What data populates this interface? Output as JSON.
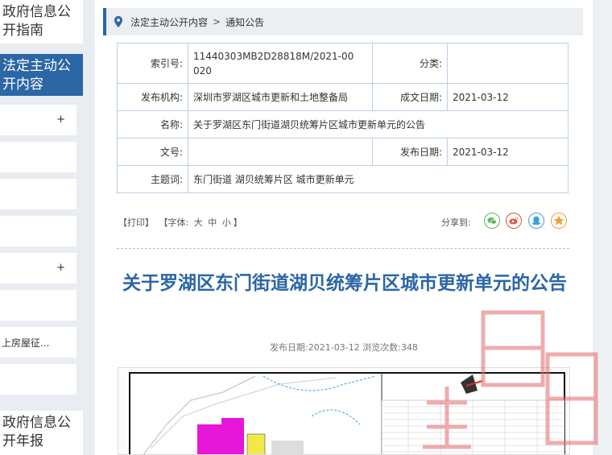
{
  "sidebar": {
    "guide": "政府信息公开指南",
    "active": "法定主动公开内容",
    "items": [
      "",
      "",
      "",
      "",
      "",
      "",
      "上房屋征...",
      ""
    ],
    "annual": "政府信息公开年报"
  },
  "breadcrumb": {
    "level1": "法定主动公开内容",
    "separator": ">",
    "level2": "通知公告"
  },
  "meta": {
    "index_label": "索引号:",
    "index_value": "11440303MB2D28818M/2021-00020",
    "category_label": "分类:",
    "category_value": "",
    "org_label": "发布机构:",
    "org_value": "深圳市罗湖区城市更新和土地整备局",
    "date_written_label": "成文日期:",
    "date_written_value": "2021-03-12",
    "name_label": "名称:",
    "name_value": "关于罗湖区东门街道湖贝统筹片区城市更新单元的公告",
    "docno_label": "文号:",
    "docno_value": "",
    "pub_date_label": "发布日期:",
    "pub_date_value": "2021-03-12",
    "subject_label": "主题词:",
    "subject_value": "东门街道 湖贝统筹片区 城市更新单元"
  },
  "tools": {
    "print": "【打印】",
    "font_label": "【字体:",
    "font_big": "大",
    "font_mid": "中",
    "font_small": "小",
    "font_close": "】",
    "share_label": "分享到:"
  },
  "article": {
    "title": "关于罗湖区东门街道湖贝统筹片区城市更新单元的公告",
    "pub_label": "发布日期:",
    "pub_date": "2021-03-12",
    "views_label": "浏览次数:",
    "views": "348"
  },
  "share_icons": [
    {
      "name": "wechat",
      "color": "#5cb85c"
    },
    {
      "name": "weibo",
      "color": "#e0533b"
    },
    {
      "name": "qq",
      "color": "#3fa0dc"
    },
    {
      "name": "favorite",
      "color": "#f0a030"
    }
  ],
  "colors": {
    "accent": "#2b66a5",
    "table_border": "#b9d0e6"
  }
}
